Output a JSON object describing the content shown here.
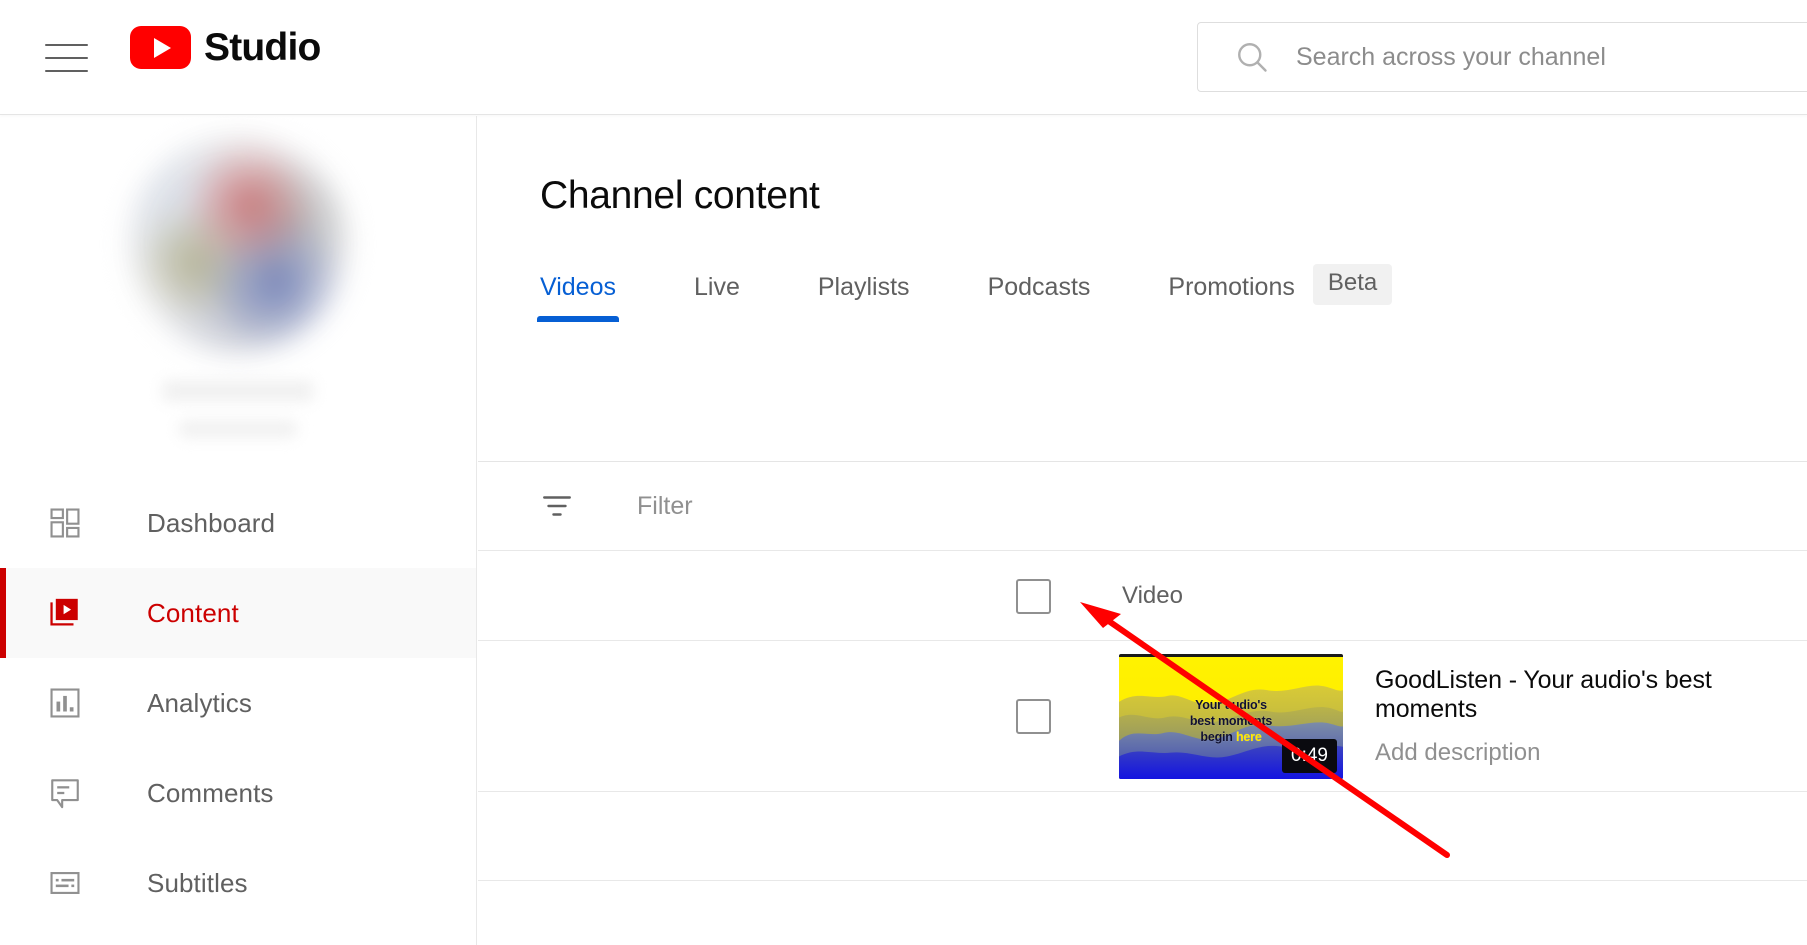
{
  "header": {
    "menu_icon": "hamburger-menu-icon",
    "logo_icon": "youtube-logo-icon",
    "brand_text": "Studio",
    "search": {
      "icon": "search-icon",
      "value": "",
      "placeholder": "Search across your channel"
    }
  },
  "sidebar": {
    "avatar": "channel-avatar-blurred",
    "channel_name_redacted": "",
    "channel_handle_redacted": "",
    "items": [
      {
        "label": "Dashboard",
        "icon": "dashboard-grid-icon",
        "active": false
      },
      {
        "label": "Content",
        "icon": "content-video-stack-icon",
        "active": true
      },
      {
        "label": "Analytics",
        "icon": "analytics-bar-chart-icon",
        "active": false
      },
      {
        "label": "Comments",
        "icon": "comments-speech-bubble-icon",
        "active": false
      },
      {
        "label": "Subtitles",
        "icon": "subtitles-caption-icon",
        "active": false
      }
    ]
  },
  "main": {
    "page_title": "Channel content",
    "tabs": [
      {
        "label": "Videos",
        "active": true
      },
      {
        "label": "Live",
        "active": false
      },
      {
        "label": "Playlists",
        "active": false
      },
      {
        "label": "Podcasts",
        "active": false
      },
      {
        "label": "Promotions",
        "active": false
      }
    ],
    "beta_badge": "Beta",
    "filter": {
      "icon": "filter-icon",
      "placeholder": "Filter",
      "value": ""
    },
    "table": {
      "columns": [
        "Video"
      ],
      "rows": [
        {
          "title": "GoodListen - Your audio's best moments",
          "description_placeholder": "Add description",
          "duration": "0:49",
          "thumbnail_text_line1": "Your audio's",
          "thumbnail_text_line2": "best moments",
          "thumbnail_text_line3a": "begin ",
          "thumbnail_text_line3b": "here",
          "selected": false
        }
      ]
    }
  },
  "annotation": {
    "type": "red-arrow",
    "points_to": "Add description",
    "color": "#FF0000"
  },
  "colors": {
    "brand_red": "#FF0000",
    "active_red": "#CC0000",
    "link_blue": "#065FD4",
    "text_primary": "#0B0B0B",
    "text_secondary": "#606060",
    "text_muted": "#909090",
    "border": "#E5E5E5",
    "active_bg": "#F9F9F9",
    "badge_bg": "#F1F1F1"
  }
}
